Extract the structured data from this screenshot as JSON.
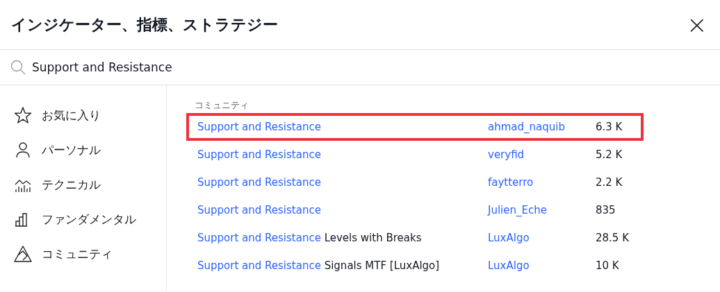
{
  "dialog": {
    "title": "インジケーター、指標、ストラテジー",
    "close_label": "×"
  },
  "search": {
    "value": "Support and Resistance"
  },
  "sidebar": {
    "items": [
      {
        "label": "お気に入り",
        "kind": "star",
        "selected": false
      },
      {
        "label": "パーソナル",
        "kind": "person",
        "selected": false
      },
      {
        "label": "テクニカル",
        "kind": "technical",
        "selected": false
      },
      {
        "label": "ファンダメンタル",
        "kind": "fundamental",
        "selected": false
      },
      {
        "label": "コミュニティ",
        "kind": "community",
        "selected": false
      }
    ]
  },
  "results": {
    "section": "コミュニティ",
    "rows": [
      {
        "match": "Support and Resistance",
        "rest": "",
        "author": "ahmad_naquib",
        "count": "6.3 K",
        "highlighted": true
      },
      {
        "match": "Support and Resistance",
        "rest": "",
        "author": "veryfid",
        "count": "5.2 K",
        "highlighted": false
      },
      {
        "match": "Support and Resistance",
        "rest": "",
        "author": "faytterro",
        "count": "2.2 K",
        "highlighted": false
      },
      {
        "match": "Support and Resistance",
        "rest": "",
        "author": "Julien_Eche",
        "count": "835",
        "highlighted": false
      },
      {
        "match": "Support and Resistance",
        "rest": "Levels with Breaks",
        "author": "LuxAlgo",
        "count": "28.5 K",
        "highlighted": false
      },
      {
        "match": "Support and Resistance",
        "rest": "Signals MTF [LuxAlgo]",
        "author": "LuxAlgo",
        "count": "10 K",
        "highlighted": false
      }
    ]
  }
}
